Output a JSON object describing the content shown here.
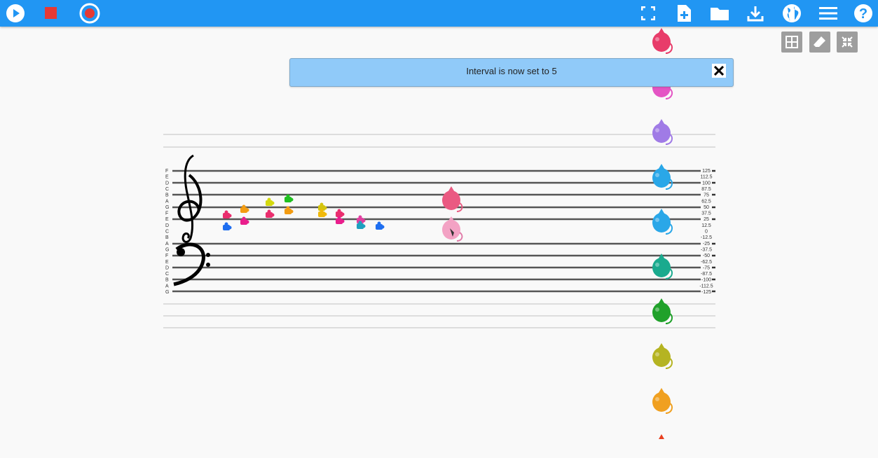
{
  "toolbar": {
    "left_buttons": [
      "play-icon",
      "stop-icon",
      "record-icon"
    ],
    "right_buttons": [
      "fullscreen-icon",
      "new-file-icon",
      "open-folder-icon",
      "download-icon",
      "globe-icon",
      "menu-icon",
      "help-icon"
    ]
  },
  "aux_tools": [
    "grid-icon",
    "eraser-icon",
    "collapse-icon"
  ],
  "toast": {
    "message": "Interval is now set to 5",
    "close_label": "✕"
  },
  "staff": {
    "note_letters": [
      "F",
      "E",
      "D",
      "C",
      "B",
      "A",
      "G",
      "F",
      "E",
      "D",
      "C",
      "B",
      "A",
      "G",
      "F",
      "E",
      "D",
      "C",
      "B",
      "A",
      "G"
    ],
    "scale_labels": [
      "125",
      "112.5",
      "100",
      "87.5",
      "75",
      "62.5",
      "50",
      "37.5",
      "25",
      "12.5",
      "0",
      "-12.5",
      "-25",
      "-37.5",
      "-50",
      "-62.5",
      "-75",
      "-87.5",
      "-100",
      "-112.5",
      "-125"
    ]
  },
  "colors": {
    "toolbar": "#2196f3",
    "toast_bg": "#90caf9",
    "mice": [
      "#e83c6a",
      "#e455c4",
      "#a07be6",
      "#2aa7e8",
      "#2aa7e8",
      "#1aaa8e",
      "#20a12a",
      "#b5b422",
      "#f0a020"
    ]
  }
}
